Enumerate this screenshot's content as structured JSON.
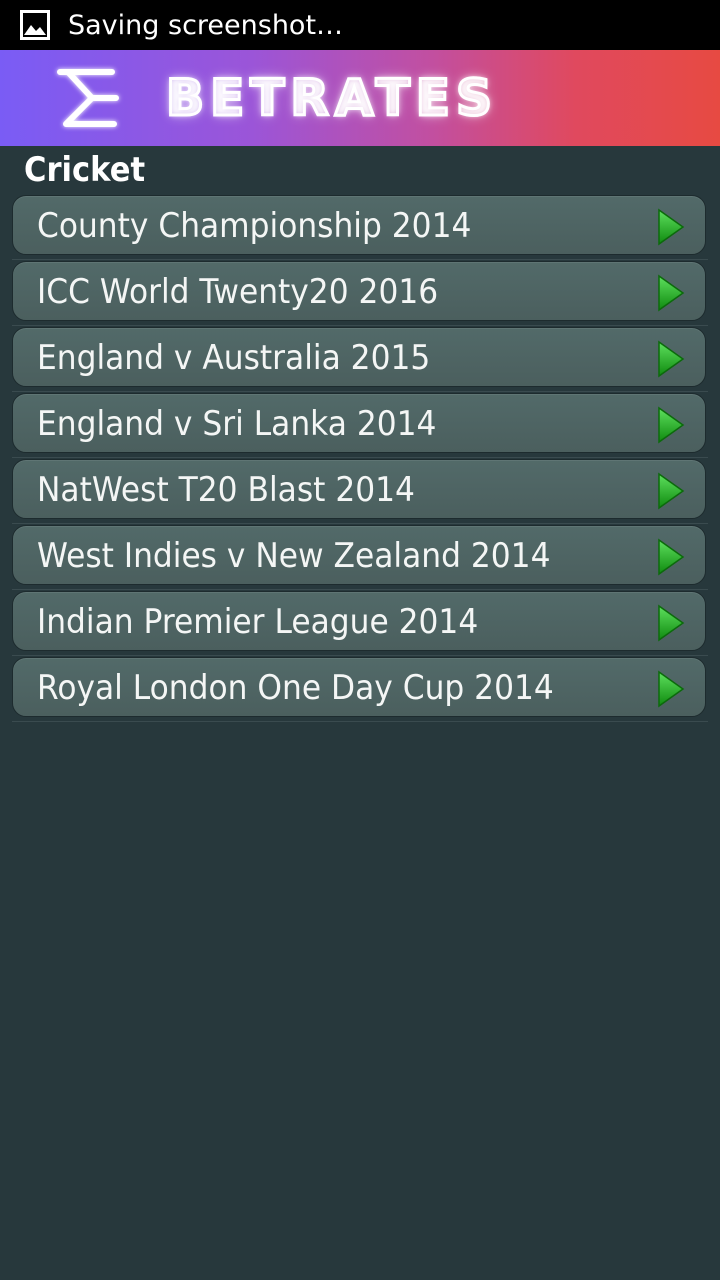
{
  "status_bar": {
    "text": "Saving screenshot…",
    "icon": "image-icon"
  },
  "banner": {
    "title": "BETRATES",
    "logo_icon": "betrates-logo-icon",
    "gradient_colors": [
      "#7a5cf5",
      "#c24fa0",
      "#e74a42"
    ]
  },
  "section": {
    "title": "Cricket"
  },
  "items": [
    {
      "label": "County Championship 2014"
    },
    {
      "label": "ICC World Twenty20 2016"
    },
    {
      "label": "England v Australia 2015"
    },
    {
      "label": "England v Sri Lanka 2014"
    },
    {
      "label": "NatWest T20 Blast 2014"
    },
    {
      "label": "West Indies v New Zealand 2014"
    },
    {
      "label": "Indian Premier League 2014"
    },
    {
      "label": "Royal London One Day Cup 2014"
    }
  ],
  "item_icon": "green-arrow-right-icon",
  "colors": {
    "background": "#27383c",
    "item_background": "#4e6463",
    "arrow": "#1fb01f"
  }
}
